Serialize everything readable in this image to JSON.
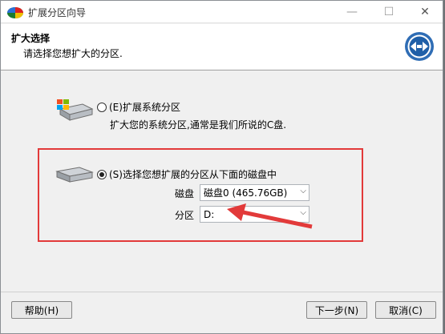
{
  "window": {
    "title": "扩展分区向导"
  },
  "header": {
    "title": "扩大选择",
    "subtitle": "请选择您想扩大的分区."
  },
  "options": {
    "system": {
      "label": "(E)扩展系统分区",
      "description": "扩大您的系统分区,通常是我们所说的C盘."
    },
    "select": {
      "label": "(S)选择您想扩展的分区从下面的磁盘中",
      "disk_label": "磁盘",
      "disk_value": "磁盘0 (465.76GB)",
      "partition_label": "分区",
      "partition_value": "D:"
    }
  },
  "buttons": {
    "help": "帮助(H)",
    "next": "下一步(N)",
    "cancel": "取消(C)"
  },
  "window_controls": {
    "minimize": "—",
    "maximize": "☐",
    "close": "✕"
  },
  "icons": {
    "app": "app-logo-icon",
    "header_logo": "partition-resize-icon",
    "system_drive": "windows-drive-icon",
    "disk_drive": "hard-disk-icon"
  },
  "colors": {
    "highlight": "#e23a3a",
    "logo_blue": "#1f5fa8"
  }
}
